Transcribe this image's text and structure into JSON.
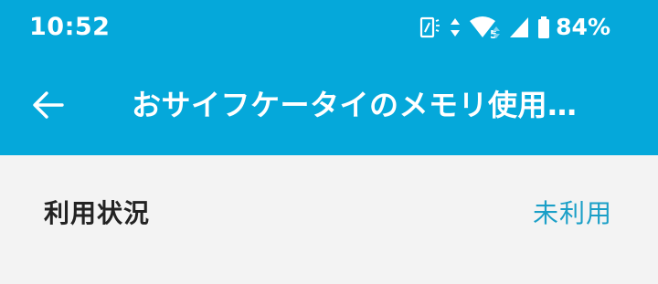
{
  "status_bar": {
    "time": "10:52",
    "battery_percent": "84%",
    "icons": [
      "nfc-icon",
      "data-arrows-icon",
      "wifi-icon",
      "signal-icon",
      "battery-icon"
    ],
    "wifi_label": "5"
  },
  "app_bar": {
    "back_icon": "arrow-left-icon",
    "title": "おサイフケータイのメモリ使用…",
    "background_color": "#05a8da"
  },
  "usage": {
    "label": "利用状況",
    "value": "未利用",
    "value_color": "#1a9fc7"
  }
}
